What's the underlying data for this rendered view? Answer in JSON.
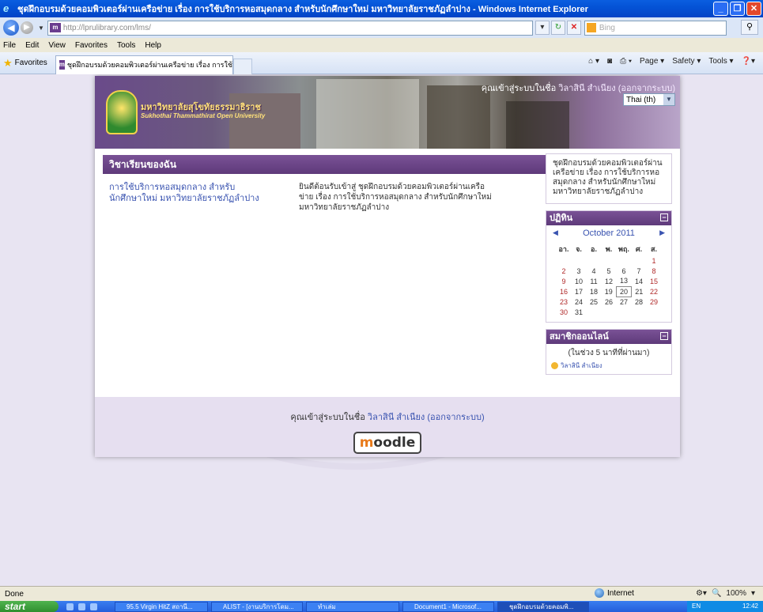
{
  "window": {
    "title": "ชุดฝึกอบรมด้วยคอมพิวเตอร์ผ่านเครือข่าย เรื่อง การใช้บริการหอสมุดกลาง สำหรับนักศึกษาใหม่ มหาวิทยาลัยราชภัฏลำปาง - Windows Internet Explorer"
  },
  "address_bar": {
    "url": "http://lprulibrary.com/lms/",
    "search_placeholder": "Bing"
  },
  "menu": [
    "File",
    "Edit",
    "View",
    "Favorites",
    "Tools",
    "Help"
  ],
  "favorites_bar": {
    "favorites_label": "Favorites",
    "tab_title": "ชุดฝึกอบรมด้วยคอมพิวเตอร์ผ่านเครือข่าย เรื่อง การใช้บริ...",
    "commands": [
      "Page ▾",
      "Safety ▾",
      "Tools ▾"
    ]
  },
  "header": {
    "univ_name_th": "มหาวิทยาลัยสุโขทัยธรรมาธิราช",
    "univ_name_en": "Sukhothai Thammathirat Open University",
    "login_prefix": "คุณเข้าสู่ระบบในชื่อ",
    "user_name": "วิลาสินี สำเนียง",
    "logout_label": "(ออกจากระบบ)",
    "language": "Thai (th)"
  },
  "my_courses": {
    "title": "วิชาเรียนของฉัน",
    "course_name": "การใช้บริการหอสมุดกลาง สำหรับนักศึกษาใหม่ มหาวิทยาลัยราชภัฏลำปาง",
    "course_summary": "ยินดีต้อนรับเข้าสู่ ชุดฝึกอบรมด้วยคอมพิวเตอร์ผ่านเครือข่าย เรื่อง การใช้บริการหอสมุดกลาง สำหรับนักศึกษาใหม่ มหาวิทยาลัยราชภัฏลำปาง"
  },
  "sidebar": {
    "site_description": "ชุดฝึกอบรมด้วยคอมพิวเตอร์ผ่านเครือข่าย เรื่อง การใช้บริการหอสมุดกลาง สำหรับนักศึกษาใหม่ มหาวิทยาลัยราชภัฏลำปาง",
    "calendar": {
      "title": "ปฏิทิน",
      "month": "October 2011",
      "weekdays": [
        "อา.",
        "จ.",
        "อ.",
        "พ.",
        "พฤ.",
        "ศ.",
        "ส."
      ],
      "weeks": [
        [
          "",
          "",
          "",
          "",
          "",
          "",
          "1"
        ],
        [
          "2",
          "3",
          "4",
          "5",
          "6",
          "7",
          "8"
        ],
        [
          "9",
          "10",
          "11",
          "12",
          "13",
          "14",
          "15"
        ],
        [
          "16",
          "17",
          "18",
          "19",
          "20",
          "21",
          "22"
        ],
        [
          "23",
          "24",
          "25",
          "26",
          "27",
          "28",
          "29"
        ],
        [
          "30",
          "31",
          "",
          "",
          "",
          "",
          ""
        ]
      ],
      "today": "20"
    },
    "online_users": {
      "title": "สมาชิกออนไลน์",
      "note": "(ในช่วง 5 นาทีที่ผ่านมา)",
      "users": [
        "วิลาสินี สำเนียง"
      ]
    }
  },
  "footer": {
    "login_prefix": "คุณเข้าสู่ระบบในชื่อ",
    "user_name": "วิลาสินี สำเนียง",
    "logout_label": "(ออกจากระบบ)",
    "logo_text_a": "m",
    "logo_text_b": "oodle"
  },
  "status_bar": {
    "status": "Done",
    "zone": "Internet",
    "zoom": "100%"
  },
  "taskbar": {
    "start_label": "start",
    "buttons": [
      "95.5 Virgin HitZ สถานี...",
      "ALIST - [งานบริการโดม...",
      "ทำเล่ม",
      "Document1 - Microsof...",
      "ชุดฝึกอบรมด้วยคอมพิ..."
    ],
    "tray_lang": "EN",
    "clock": "12:42"
  },
  "colors": {
    "block_header": "#6b4589",
    "link": "#3953b0",
    "page_bg": "#e8e4f2"
  }
}
